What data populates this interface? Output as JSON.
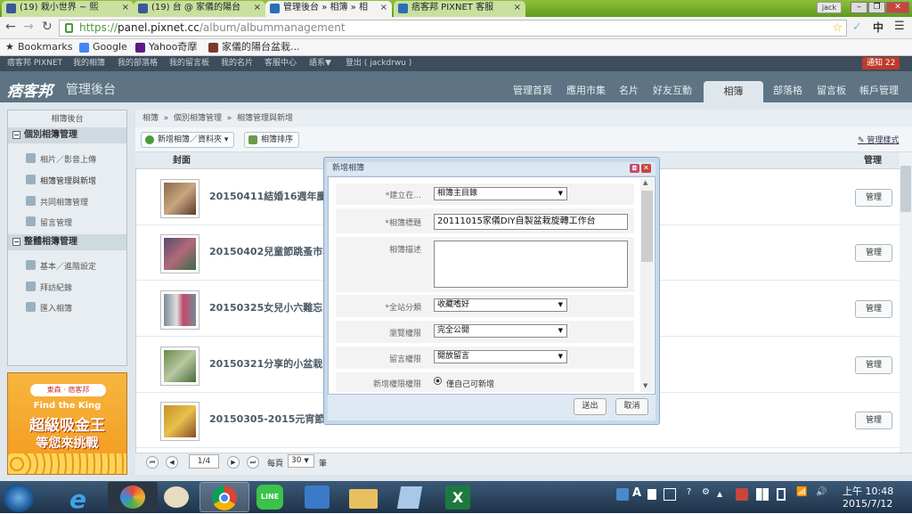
{
  "browser": {
    "tabs": [
      {
        "label": "(19) 栽小世界 ~ 熙",
        "fav": "#3b5998"
      },
      {
        "label": "(19) 台 @ 家儀的陽台",
        "fav": "#3b5998"
      },
      {
        "label": "管理後台 » 相簿 » 相",
        "fav": "#2a6fb5"
      },
      {
        "label": "痞客邦 PIXNET 客服",
        "fav": "#2a6fb5"
      }
    ],
    "user": "jack",
    "url_prefix": "https://",
    "url_host": "panel.pixnet.cc",
    "url_path": "/album/albummanagement",
    "bookmarks": [
      "Bookmarks",
      "Google",
      "Yahoo奇摩",
      "家儀的陽台盆栽..."
    ],
    "ime": "中",
    "menu_icon": "☰"
  },
  "site": {
    "topnav": [
      "痞客邦 PIXNET",
      "我的相簿",
      "我的部落格",
      "我的留言板",
      "我的名片",
      "客服中心",
      "語系▼",
      "登出 ( jackdrwu )"
    ],
    "notice": "通知 22",
    "logo": "痞客邦",
    "title": "管理後台",
    "nav": [
      "管理首頁",
      "應用市集",
      "名片",
      "好友互動",
      "相簿",
      "部落格",
      "留言板",
      "帳戶管理"
    ]
  },
  "sidebar": {
    "title": "相簿後台",
    "section1": "個別相簿管理",
    "items1": [
      "相片／影音上傳",
      "相簿管理與新增",
      "共同相簿管理",
      "留言管理"
    ],
    "section2": "整體相簿管理",
    "items2": [
      "基本／進階設定",
      "拜訪紀錄",
      "匯入相簿"
    ]
  },
  "ad": {
    "brand1": "東森",
    "brand2": "痞客邦",
    "line1": "Find the King",
    "line2": "超級吸金王",
    "line3": "等您來挑戰"
  },
  "main": {
    "breadcrumb": [
      "相簿",
      "個別相簿管理",
      "相簿管理與新增"
    ],
    "btn_new": "新增相簿／資料夾",
    "btn_sort": "相簿排序",
    "manage_style": "管理樣式",
    "col_cover": "封面",
    "col_manage": "管理",
    "rows": [
      {
        "title": "20150411結婚16週年慶及兒",
        "color": "#8a6a4a",
        "btn": "管理"
      },
      {
        "title": "20150402兒童節跳蚤市場~赴",
        "color": "#5a4a6a",
        "btn": "管理"
      },
      {
        "title": "20150325女兒小六難忘的畢",
        "color": "#7a8a9a",
        "btn": "管理"
      },
      {
        "title": "20150321分享的小盆栽(17",
        "color": "#6a8a4a",
        "btn": "管理"
      },
      {
        "title": "20150305-2015元宵節~廟",
        "color": "#c4902a",
        "btn": "管理"
      }
    ],
    "pager": {
      "page": "1/4",
      "per_label": "每頁",
      "per_value": "30",
      "unit": "筆"
    }
  },
  "dialog": {
    "title": "新增相簿",
    "fields": {
      "parent_label": "*建立在...",
      "parent_value": "相簿主目錄",
      "name_label": "*相簿標題",
      "name_value": "20111015家儀DIY自製盆栽旋轉工作台",
      "desc_label": "相簿描述",
      "cat_label": "*全站分類",
      "cat_value": "收藏嗜好",
      "view_label": "瀏覽權限",
      "view_value": "完全公開",
      "comment_label": "留言權限",
      "comment_value": "開放留言",
      "upload_label": "新增權限權限",
      "upload_value": "僅自己可新增"
    },
    "submit": "送出",
    "cancel": "取消"
  },
  "taskbar": {
    "time": "上午 10:48",
    "date": "2015/7/12"
  }
}
